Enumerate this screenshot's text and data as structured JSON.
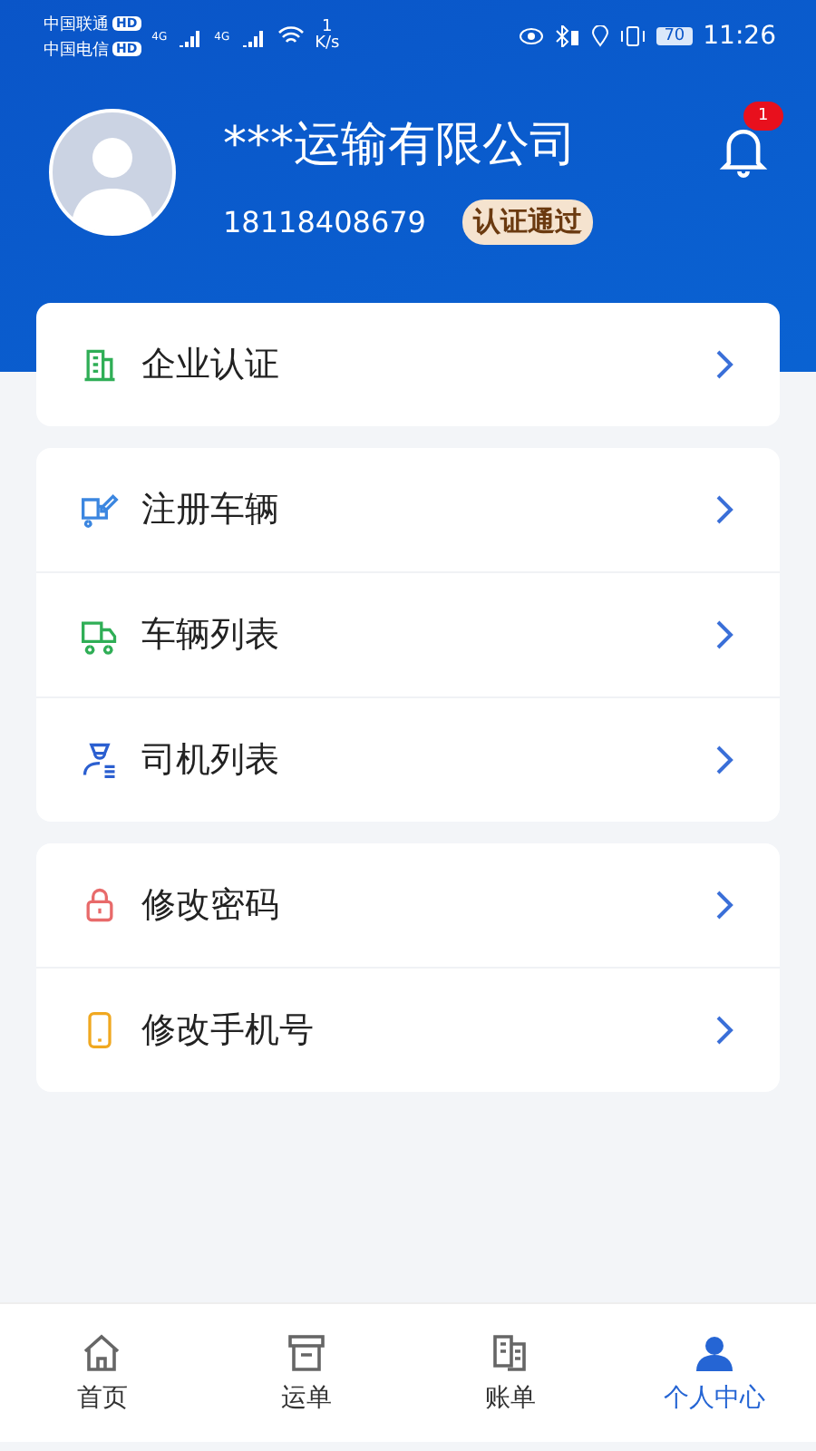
{
  "status_bar": {
    "carriers": [
      {
        "name": "中国联通",
        "badge": "HD"
      },
      {
        "name": "中国电信",
        "badge": "HD"
      }
    ],
    "network": [
      "4G",
      "4G"
    ],
    "speed": "1",
    "speed_unit": "K/s",
    "battery": "70",
    "time": "11:26"
  },
  "profile": {
    "company": "***运输有限公司",
    "phone": "18118408679",
    "badge": "认证通过",
    "notifications": "1"
  },
  "menu_groups": [
    [
      {
        "kind": "building",
        "label": "企业认证"
      }
    ],
    [
      {
        "kind": "truck-edit",
        "label": "注册车辆"
      },
      {
        "kind": "truck",
        "label": "车辆列表"
      },
      {
        "kind": "driver",
        "label": "司机列表"
      }
    ],
    [
      {
        "kind": "lock",
        "label": "修改密码"
      },
      {
        "kind": "phone",
        "label": "修改手机号"
      }
    ]
  ],
  "tab_bar": [
    {
      "kind": "home",
      "label": "首页",
      "selected": false
    },
    {
      "kind": "box",
      "label": "运单",
      "selected": false
    },
    {
      "kind": "bill",
      "label": "账单",
      "selected": false
    },
    {
      "kind": "user",
      "label": "个人中心",
      "selected": true
    }
  ]
}
